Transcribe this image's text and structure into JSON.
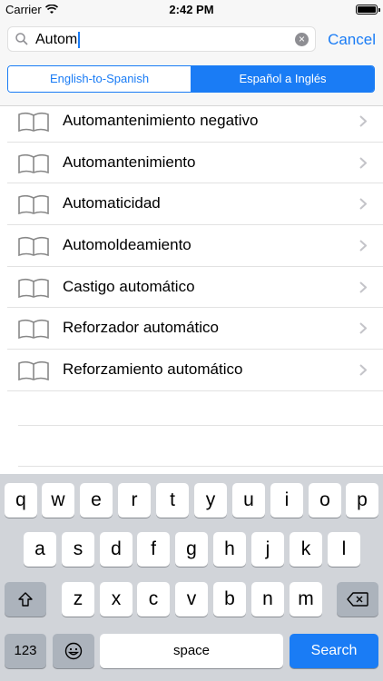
{
  "status": {
    "carrier": "Carrier",
    "time": "2:42 PM"
  },
  "search": {
    "query": "Autom",
    "cancel": "Cancel"
  },
  "segments": [
    {
      "label": "English-to-Spanish",
      "selected": true
    },
    {
      "label": "Español a Inglés",
      "selected": false
    }
  ],
  "results": [
    {
      "title": "Automantenimiento negativo"
    },
    {
      "title": "Automantenimiento"
    },
    {
      "title": "Automaticidad"
    },
    {
      "title": "Automoldeamiento"
    },
    {
      "title": "Castigo automático"
    },
    {
      "title": "Reforzador automático"
    },
    {
      "title": "Reforzamiento automático"
    }
  ],
  "keyboard": {
    "row1": [
      "q",
      "w",
      "e",
      "r",
      "t",
      "y",
      "u",
      "i",
      "o",
      "p"
    ],
    "row2": [
      "a",
      "s",
      "d",
      "f",
      "g",
      "h",
      "j",
      "k",
      "l"
    ],
    "row3": [
      "z",
      "x",
      "c",
      "v",
      "b",
      "n",
      "m"
    ],
    "numbers": "123",
    "space": "space",
    "search": "Search"
  },
  "colors": {
    "accent": "#1a7cf5",
    "keyboard_bg": "#d1d4d9"
  }
}
